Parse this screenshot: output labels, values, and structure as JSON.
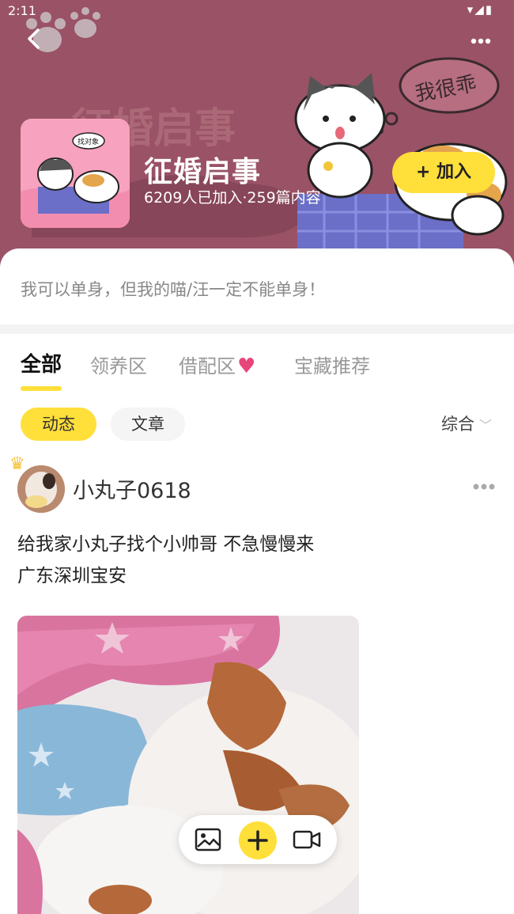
{
  "status_bar": {
    "time": "2:11",
    "icons": "▾◢▮"
  },
  "header": {
    "back_icon": "back-arrow-icon",
    "more_icon": "more-dots-icon",
    "banner_sticker_text": "我很乖",
    "banner_bg_text": "征婚启事"
  },
  "group": {
    "title": "征婚启事",
    "stats": "6209人已加入·259篇内容",
    "join_label": "+ 加入",
    "description": "我可以单身，但我的喵/汪一定不能单身！",
    "thumb_sticker_text": "找对象"
  },
  "tabs": [
    {
      "label": "全部",
      "active": true
    },
    {
      "label": "领养区",
      "active": false
    },
    {
      "label": "借配区",
      "active": false
    },
    {
      "label": "宝藏推荐",
      "active": false
    }
  ],
  "filters": {
    "chips": [
      {
        "label": "动态",
        "selected": true
      },
      {
        "label": "文章",
        "selected": false
      }
    ],
    "sort_label": "综合"
  },
  "post": {
    "username": "小丸子0618",
    "text_line1": "给我家小丸子找个小帅哥 不急慢慢来",
    "text_line2": "广东深圳宝安"
  },
  "colors": {
    "banner": "#9a5266",
    "accent": "#ffdf3a",
    "heart": "#e8457a"
  }
}
